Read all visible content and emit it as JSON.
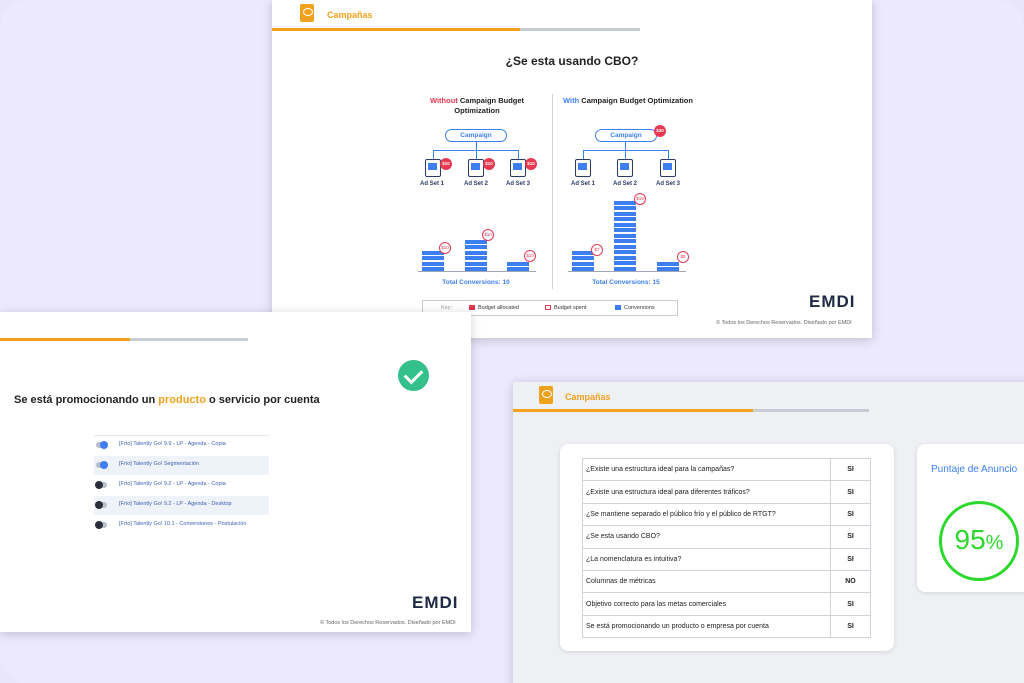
{
  "slide1": {
    "header": "Campañas",
    "question": "¿Se esta usando CBO?",
    "without_col": {
      "highlight": "Without",
      "title": "Campaign Budget Optimization",
      "campaign": "Campaign",
      "adsets": [
        "Ad Set 1",
        "Ad Set 2",
        "Ad Set 3"
      ],
      "badges": [
        "$10",
        "$10",
        "$10"
      ],
      "bar_badges": [
        "$10",
        "$10",
        "$10"
      ],
      "total": "Total Conversions: 10"
    },
    "with_col": {
      "highlight": "With",
      "title": "Campaign Budget Optimization",
      "campaign": "Campaign",
      "campaign_badge": "$30",
      "adsets": [
        "Ad Set 1",
        "Ad Set 2",
        "Ad Set 3"
      ],
      "bar_badges": [
        "$7",
        "$18",
        "$5"
      ],
      "total": "Total Conversions: 15"
    },
    "key": {
      "label": "Key:",
      "items": [
        "Budget allocated",
        "Budget spent",
        "Conversions"
      ]
    },
    "logo": "EMDI",
    "footer": "© Todos los Derechos Reservados. Diseñado por EMDI"
  },
  "slide2": {
    "title_pre": "Se está promocionando un ",
    "title_hl": "producto",
    "title_post": " o servicio por cuenta",
    "rows": [
      {
        "label": "[Frío] Talently Go! 9.9 - LP - Agenda - Copia",
        "on": true
      },
      {
        "label": "[Frío] Talently Go! Segmentación",
        "on": true
      },
      {
        "label": "[Frío] Talently Go! 9.2 - LP - Agenda - Copia",
        "on": false
      },
      {
        "label": "[Frío] Talently Go! 9.2 - LP - Agenda - Desktop",
        "on": false
      },
      {
        "label": "[Frío] Talently Go! 10.1 - Conversiones - Postulación",
        "on": false
      }
    ],
    "logo": "EMDI",
    "footer": "© Todos los Derechos Reservados. Diseñado por EMDI"
  },
  "slide3": {
    "header": "Campañas",
    "table": [
      [
        "¿Existe una estructura ideal para la campañas?",
        "SI"
      ],
      [
        "¿Existe una estructura ideal para diferentes tráficos?",
        "SI"
      ],
      [
        "¿Se mantiene separado el público frío y el público de RTGT?",
        "SI"
      ],
      [
        "¿Se esta usando CBO?",
        "SI"
      ],
      [
        "¿La nomenclatura es intuitiva?",
        "SI"
      ],
      [
        "Columnas de métricas",
        "NO"
      ],
      [
        "Objetivo correcto para las metas comerciales",
        "SI"
      ],
      [
        "Se está promocionando un producto o empresa por cuenta",
        "SI"
      ]
    ],
    "score_title": "Puntaje de Anuncio",
    "score_value": "95",
    "score_unit": "%"
  },
  "colors": {
    "accent": "#f0a21e",
    "blue": "#3d7ef0",
    "red": "#e53951",
    "green": "#2bd82b",
    "check": "#33c08a"
  }
}
